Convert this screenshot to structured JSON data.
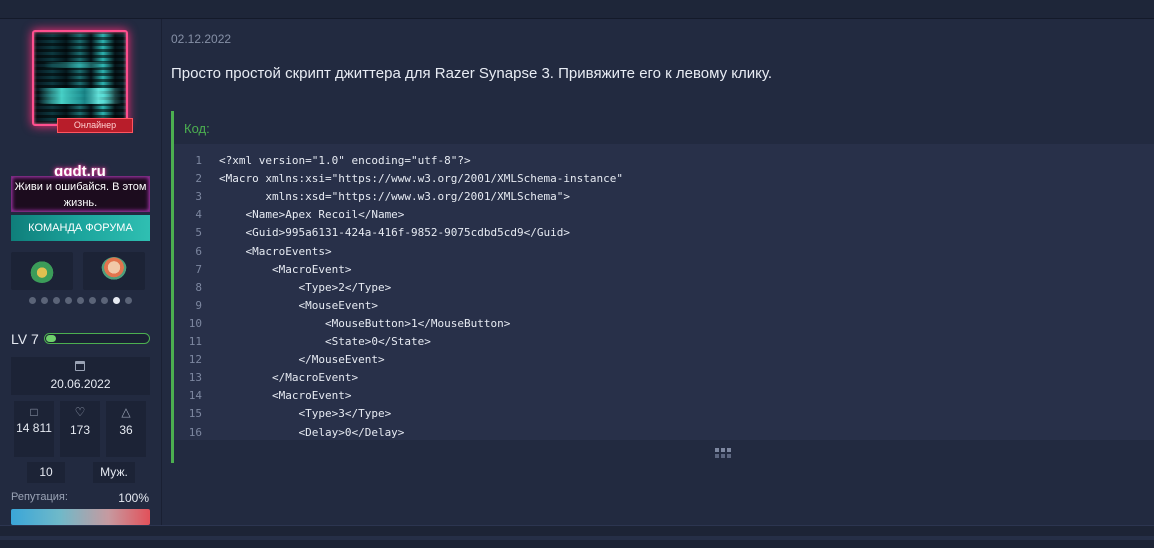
{
  "user": {
    "avatar_badge": "Онлайнер",
    "username": "ggdt.ru",
    "title": "Живи и ошибайся. В этом жизнь.",
    "team_banner": "КОМАНДА ФОРУМА",
    "level": "LV 7",
    "level_progress": 0.1,
    "joined": "20.06.2022",
    "stats": {
      "messages": "14 811",
      "reactions": "173",
      "points": "36"
    },
    "box_left": "10",
    "gender": "Муж.",
    "reputation_label": "Репутация:",
    "reputation_value": "100%",
    "award_dots_count": 9,
    "award_dots_active": 8
  },
  "post": {
    "date": "02.12.2022",
    "text": "Просто простой скрипт джиттера для Razer Synapse 3. Привяжите его к левому клику.",
    "code_label": "Код:",
    "code_lines": [
      "<?xml version=\"1.0\" encoding=\"utf-8\"?>",
      "<Macro xmlns:xsi=\"https://www.w3.org/2001/XMLSchema-instance\"",
      "       xmlns:xsd=\"https://www.w3.org/2001/XMLSchema\">",
      "    <Name>Apex Recoil</Name>",
      "    <Guid>995a6131-424a-416f-9852-9075cdbd5cd9</Guid>",
      "    <MacroEvents>",
      "        <MacroEvent>",
      "            <Type>2</Type>",
      "            <MouseEvent>",
      "                <MouseButton>1</MouseButton>",
      "                <State>0</State>",
      "            </MouseEvent>",
      "        </MacroEvent>",
      "        <MacroEvent>",
      "            <Type>3</Type>",
      "            <Delay>0</Delay>"
    ]
  },
  "colors": {
    "accent_green": "#4caf50",
    "neon_pink": "#ff2d78",
    "team_teal": "#1ca59d"
  }
}
